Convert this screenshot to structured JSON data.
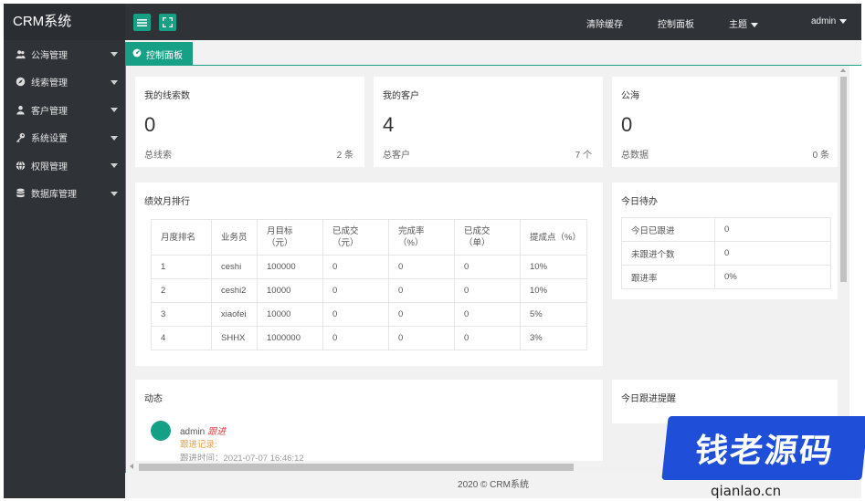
{
  "app": {
    "title": "CRM系统"
  },
  "sidebar": {
    "items": [
      {
        "label": "公海管理",
        "icon": "users-icon"
      },
      {
        "label": "线索管理",
        "icon": "compass-icon"
      },
      {
        "label": "客户管理",
        "icon": "user-icon"
      },
      {
        "label": "系统设置",
        "icon": "key-icon"
      },
      {
        "label": "权限管理",
        "icon": "globe-icon"
      },
      {
        "label": "数据库管理",
        "icon": "database-icon"
      }
    ]
  },
  "topbar": {
    "links": {
      "clear_cache": "清除缓存",
      "control_panel": "控制面板",
      "theme": "主题",
      "user": "admin"
    }
  },
  "tabs": {
    "active": "控制面板"
  },
  "stats": [
    {
      "title": "我的线索数",
      "value": "0",
      "sub_label": "总线索",
      "sub_value": "2 条"
    },
    {
      "title": "我的客户",
      "value": "4",
      "sub_label": "总客户",
      "sub_value": "7 个"
    },
    {
      "title": "公海",
      "value": "0",
      "sub_label": "总数据",
      "sub_value": "0 条"
    }
  ],
  "ranking": {
    "title": "绩效月排行",
    "headers": [
      "月度排名",
      "业务员",
      "月目标（元）",
      "已成交（元）",
      "完成率（%）",
      "已成交（单）",
      "提成点（%）"
    ],
    "rows": [
      [
        "1",
        "ceshi",
        "100000",
        "0",
        "0",
        "0",
        "10%"
      ],
      [
        "2",
        "ceshi2",
        "10000",
        "0",
        "0",
        "0",
        "10%"
      ],
      [
        "3",
        "xiaofei",
        "10000",
        "0",
        "0",
        "0",
        "5%"
      ],
      [
        "4",
        "SHHX",
        "1000000",
        "0",
        "0",
        "0",
        "3%"
      ]
    ]
  },
  "todo": {
    "title": "今日待办",
    "rows": [
      [
        "今日已跟进",
        "0"
      ],
      [
        "未跟进个数",
        "0"
      ],
      [
        "跟进率",
        "0%"
      ]
    ]
  },
  "feed": {
    "title": "动态",
    "name": "admin",
    "tag": "跟进",
    "label": "跟进记录:",
    "time": "跟进时间：2021-07-07 16:46:12"
  },
  "reminder": {
    "title": "今日跟进提醒"
  },
  "footer": {
    "text": "2020 ©   CRM系统"
  },
  "watermark": {
    "brand": "钱老源码",
    "url": "qianlao.cn"
  },
  "colors": {
    "accent": "#16a085",
    "sidebar_bg": "#2f3237",
    "watermark": "#1f4fd8"
  }
}
